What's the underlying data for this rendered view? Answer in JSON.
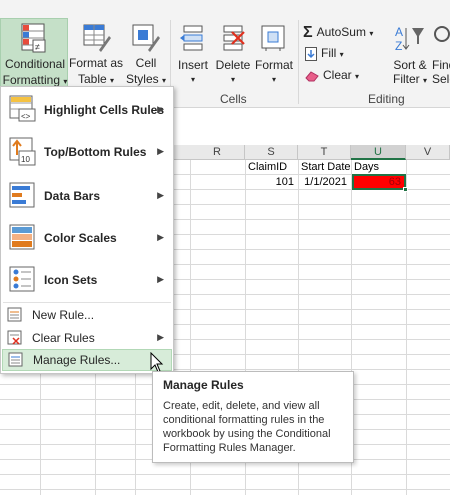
{
  "ribbon": {
    "conditional_formatting": [
      "Conditional",
      "Formatting"
    ],
    "format_as_table": [
      "Format as",
      "Table"
    ],
    "cell_styles": [
      "Cell",
      "Styles"
    ],
    "insert": "Insert",
    "delete": "Delete",
    "format": "Format",
    "cells_group": "Cells",
    "autosum": "AutoSum",
    "fill": "Fill",
    "clear": "Clear",
    "sort_filter": [
      "Sort &",
      "Filter"
    ],
    "find_select": [
      "Find",
      "Sele"
    ],
    "editing_group": "Editing"
  },
  "grid": {
    "columns": [
      "R",
      "S",
      "T",
      "U",
      "V"
    ],
    "selected_column": "U",
    "headers": {
      "S": "ClaimID",
      "T": "Start Date",
      "U": "Days"
    },
    "row": {
      "S": "101",
      "T": "1/1/2021",
      "U": "63"
    },
    "highlight_color": "#ff0000"
  },
  "menu": {
    "highlight_cells_rules": "Highlight Cells Rules",
    "top_bottom_rules": "Top/Bottom Rules",
    "data_bars": "Data Bars",
    "color_scales": "Color Scales",
    "icon_sets": "Icon Sets",
    "new_rule": "New Rule...",
    "clear_rules": "Clear Rules",
    "manage_rules": "Manage Rules..."
  },
  "tooltip": {
    "title": "Manage Rules",
    "body": "Create, edit, delete, and view all conditional formatting rules in the workbook by using the Conditional Formatting Rules Manager."
  },
  "accent": "#217346"
}
